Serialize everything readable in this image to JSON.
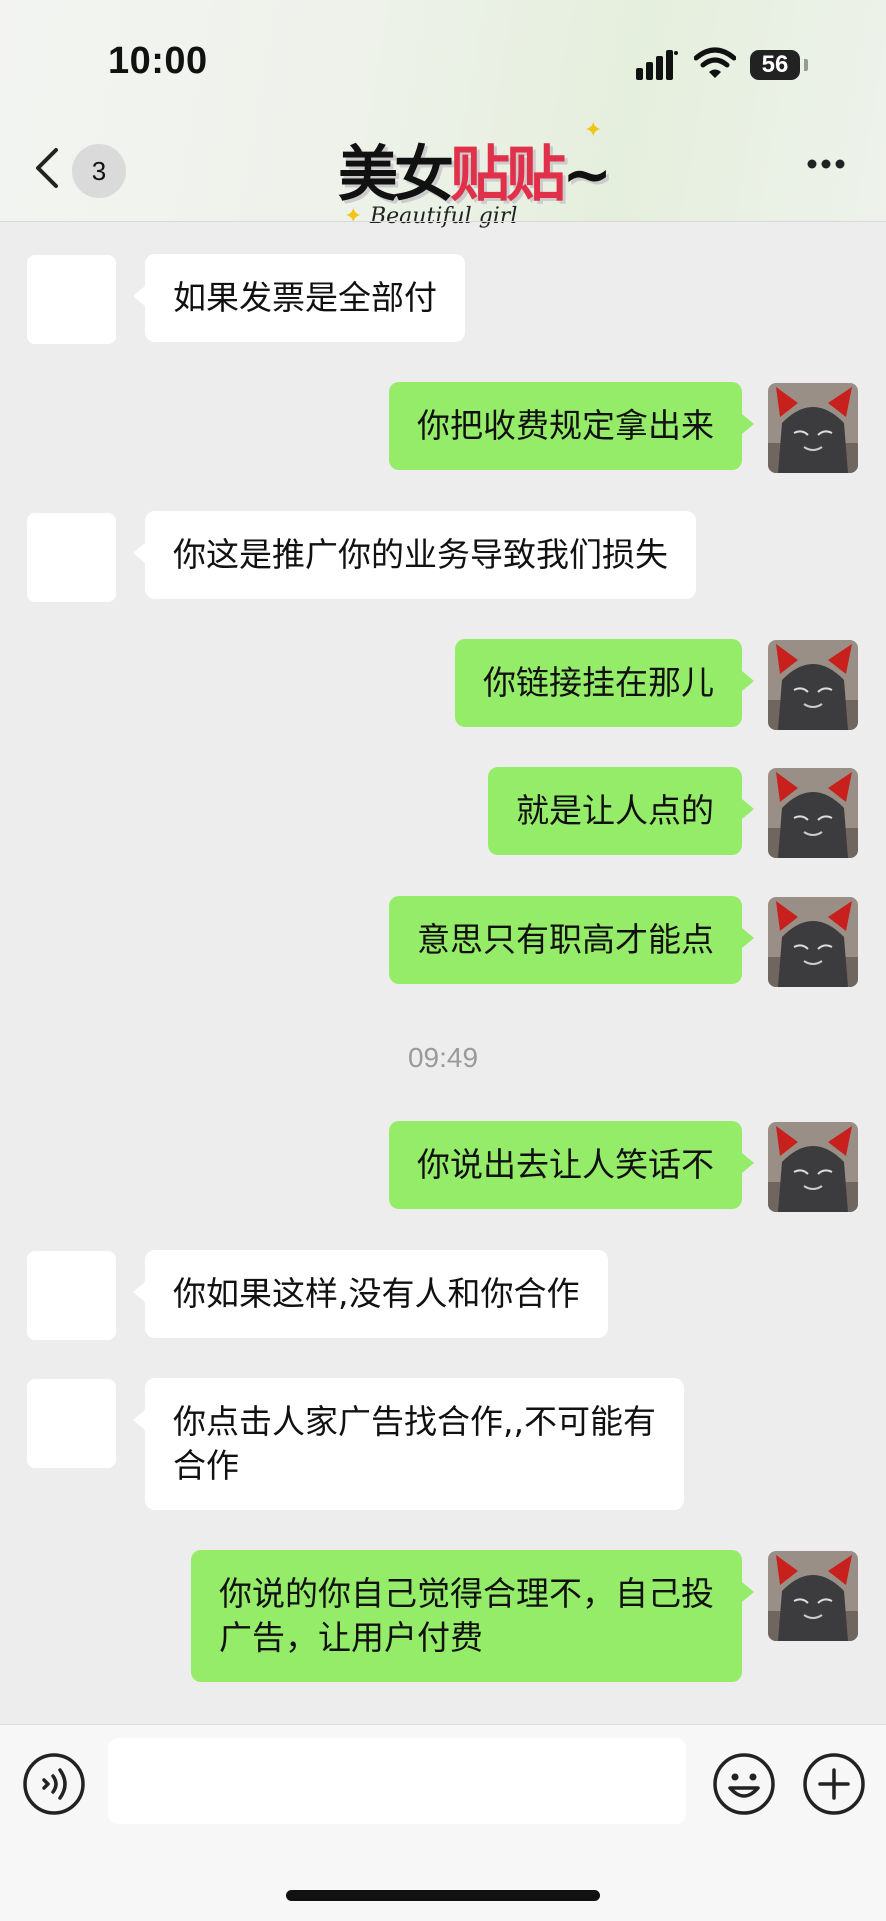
{
  "status_bar": {
    "time": "10:00",
    "battery": "56"
  },
  "header": {
    "back_icon": "chevron-left-icon",
    "unread_count": "3",
    "title_part1": "美女",
    "title_part2": "贴贴",
    "title_part3": "~",
    "title_sub": "Beautiful girl",
    "more_icon": "more-icon"
  },
  "messages": [
    {
      "side": "in",
      "text": "如果发票是全部付"
    },
    {
      "side": "out",
      "text": "你把收费规定拿出来"
    },
    {
      "side": "in",
      "text": "你这是推广你的业务导致我们损失"
    },
    {
      "side": "out",
      "text": "你链接挂在那儿"
    },
    {
      "side": "out",
      "text": "就是让人点的"
    },
    {
      "side": "out",
      "text": "意思只有职高才能点"
    },
    {
      "side": "out",
      "text": "你说出去让人笑话不"
    },
    {
      "side": "in",
      "text": "你如果这样,没有人和你合作"
    },
    {
      "side": "in",
      "text": "你点击人家广告找合作,,不可能有\n合作"
    },
    {
      "side": "out",
      "text": "你说的你自己觉得合理不，自己投\n广告，让用户付费"
    }
  ],
  "timestamp": "09:49",
  "input_bar": {
    "voice_icon": "voice-icon",
    "text_value": "",
    "emoji_icon": "emoji-icon",
    "plus_icon": "plus-icon"
  }
}
